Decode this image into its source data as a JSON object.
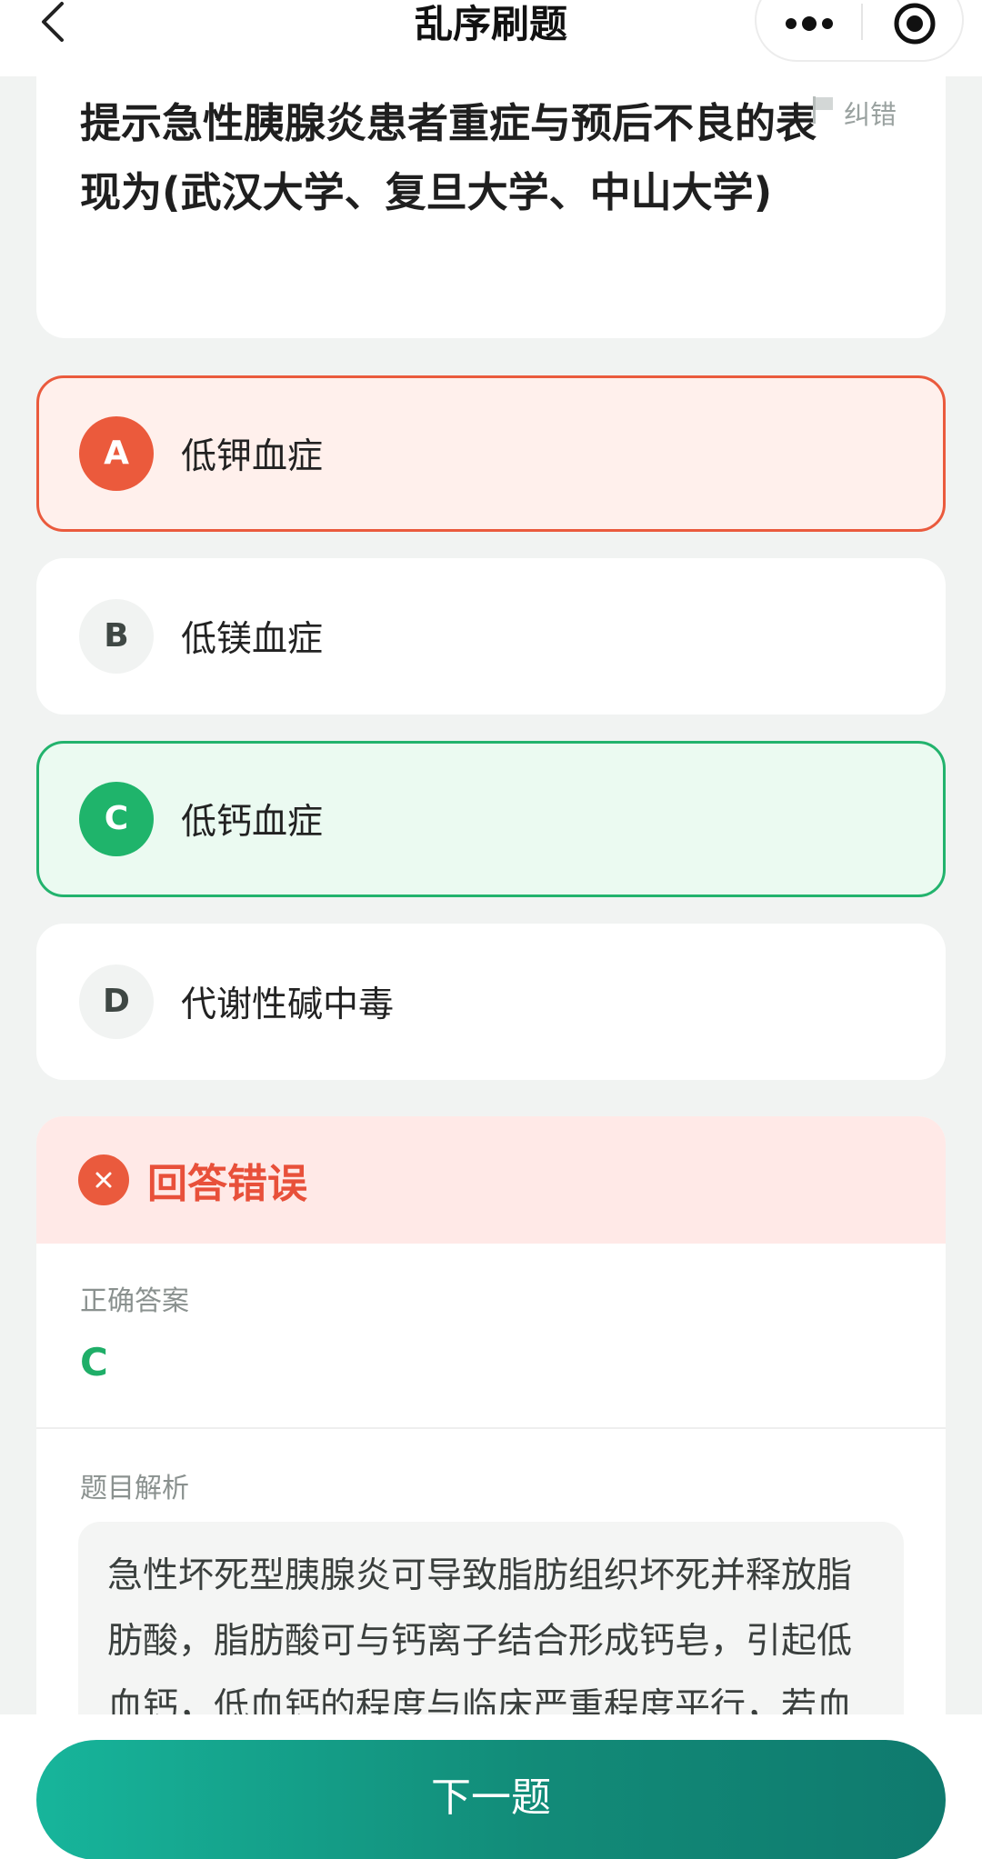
{
  "header": {
    "title": "乱序刷题",
    "back_icon": "chevron-left-icon",
    "more_icon": "more-dots-icon",
    "target_icon": "target-icon"
  },
  "question": {
    "text": "提示急性胰腺炎患者重症与预后不良的表现为(武汉大学、复旦大学、中山大学)",
    "report_label": "纠错",
    "report_icon": "flag-icon"
  },
  "options": [
    {
      "letter": "A",
      "text": "低钾血症",
      "state": "wrong"
    },
    {
      "letter": "B",
      "text": "低镁血症",
      "state": "normal"
    },
    {
      "letter": "C",
      "text": "低钙血症",
      "state": "correct"
    },
    {
      "letter": "D",
      "text": "代谢性碱中毒",
      "state": "normal"
    }
  ],
  "result": {
    "title": "回答错误",
    "icon": "close-icon",
    "answer_label": "正确答案",
    "answer_value": "C",
    "analysis_label": "题目解析",
    "analysis_text": "急性坏死型胰腺炎可导致脂肪组织坏死并释放脂肪酸，脂肪酸可与钙离子结合形成钙皂，引起低血钙，低血钙的程度与临床严重程度平行，若血"
  },
  "footer": {
    "next_label": "下一题"
  },
  "colors": {
    "wrong": "#ea5a3d",
    "correct": "#1fb46b",
    "button_start": "#17b59b",
    "button_end": "#0f7a6e"
  }
}
